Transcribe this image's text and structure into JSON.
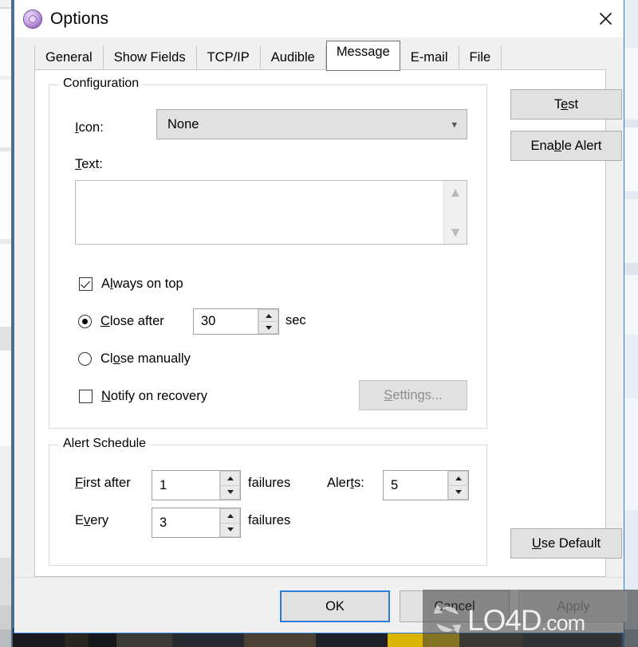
{
  "window": {
    "title": "Options",
    "icon": "target-circle-icon",
    "close_label": "✕"
  },
  "tabs": [
    {
      "label": "General",
      "selected": false
    },
    {
      "label": "Show Fields",
      "selected": false
    },
    {
      "label": "TCP/IP",
      "selected": false
    },
    {
      "label": "Audible",
      "selected": false
    },
    {
      "label": "Message",
      "selected": true
    },
    {
      "label": "E-mail",
      "selected": false
    },
    {
      "label": "File",
      "selected": false
    }
  ],
  "configuration": {
    "legend": "Configuration",
    "icon_label_pre": "I",
    "icon_label_post": "con:",
    "icon_value": "None",
    "icon_options": [
      "None"
    ],
    "text_label_pre": "T",
    "text_label_post": "ext:",
    "text_value": "",
    "text_placeholder": "",
    "always_on_top": {
      "pre": "A",
      "mid": "l",
      "post": "ways on top",
      "checked": true
    },
    "close_after": {
      "pre": "",
      "mid": "C",
      "post": "lose after",
      "selected": true,
      "value": "30",
      "unit": "sec"
    },
    "close_manually": {
      "pre": "Cl",
      "mid": "o",
      "post": "se manually",
      "selected": false
    },
    "notify_on_recovery": {
      "pre": "",
      "mid": "N",
      "post": "otify on recovery",
      "checked": false
    },
    "settings_button": {
      "pre": "",
      "mid": "S",
      "post": "ettings...",
      "disabled": true
    }
  },
  "alert_schedule": {
    "legend": "Alert Schedule",
    "first_after": {
      "pre": "",
      "mid": "F",
      "post": "irst after",
      "value": "1",
      "unit": "failures"
    },
    "every": {
      "pre": "E",
      "mid": "v",
      "post": "ery",
      "value": "3",
      "unit": "failures"
    },
    "alerts": {
      "pre": "Aler",
      "mid": "t",
      "post": "s:",
      "value": "5"
    }
  },
  "side_buttons": {
    "test": {
      "pre": "T",
      "mid": "e",
      "post": "st"
    },
    "enable_alert": {
      "pre": "Ena",
      "mid": "b",
      "post": "le Alert"
    },
    "use_default": {
      "pre": "",
      "mid": "U",
      "post": "se Default"
    }
  },
  "footer": {
    "ok": "OK",
    "cancel": "Cancel",
    "apply": "Apply",
    "apply_disabled": true,
    "ok_focused": true
  },
  "watermark": {
    "text_main": "LO4D",
    "text_suffix": ".com"
  },
  "colors": {
    "accent": "#2e7cd6",
    "dialog_bg": "#f0f0f0",
    "page_bg": "#ffffff",
    "button_face": "#e1e1e1",
    "disabled_text": "#8d8d8d"
  }
}
